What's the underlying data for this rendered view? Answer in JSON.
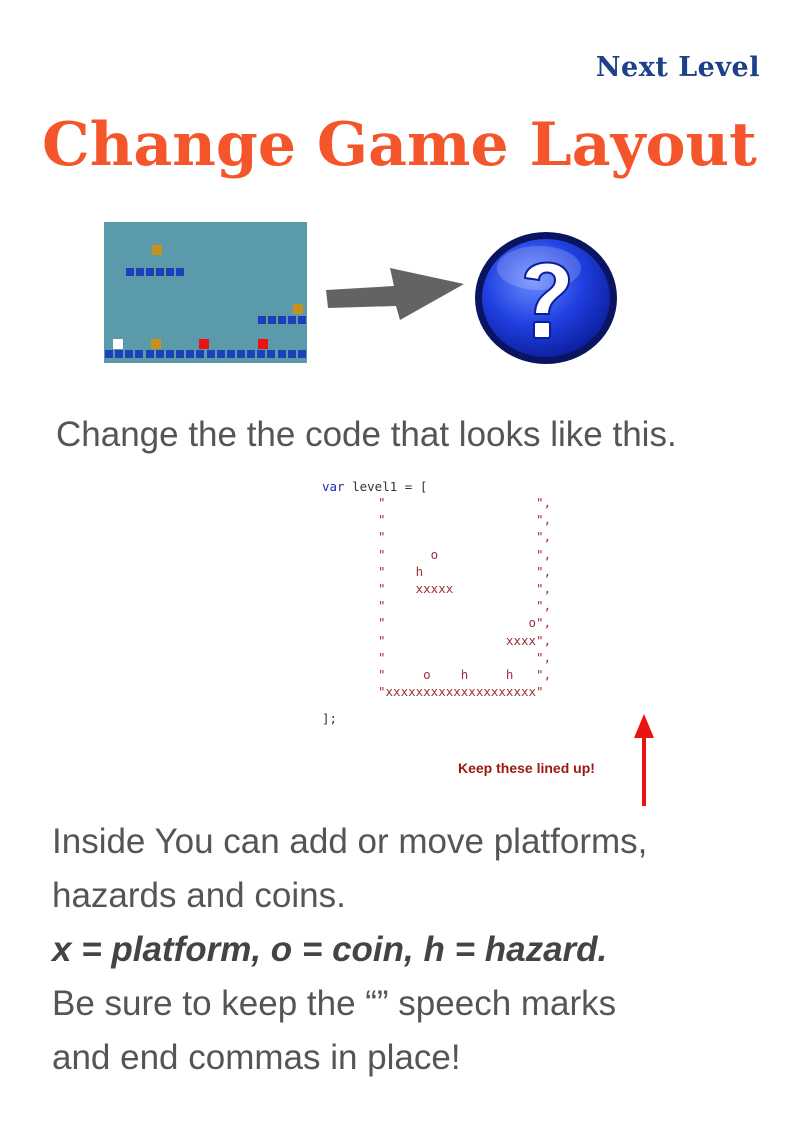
{
  "header": {
    "next_level": "Next Level",
    "title": "Change Game Layout"
  },
  "illustration": {
    "arrow_icon": "right-arrow-icon",
    "question_icon": "question-mark-icon",
    "colors": {
      "background": "#5b9aaa",
      "platform": "#1d3fb8",
      "coin": "#c8921a",
      "hazard": "#ee1111",
      "player": "#ffffff"
    }
  },
  "instruction": "Change the the code that looks like this.",
  "code": {
    "line_first": "var level1 = [",
    "rows": [
      "\"                    \",",
      "\"                    \",",
      "\"                    \",",
      "\"      o             \",",
      "\"    h               \",",
      "\"    xxxxx           \",",
      "\"                    \",",
      "\"                   o\",",
      "\"                xxxx\",",
      "\"                    \",",
      "\"     o    h     h   \",",
      "\"xxxxxxxxxxxxxxxxxxxx\""
    ],
    "line_last": "];"
  },
  "note": "Keep these lined up!",
  "body": {
    "line1": "Inside You can add or move platforms,",
    "line2": "hazards and coins.",
    "legend": "x = platform, o = coin, h = hazard.",
    "line3": "Be sure to keep the “” speech marks",
    "line4": "and end commas in place!"
  }
}
